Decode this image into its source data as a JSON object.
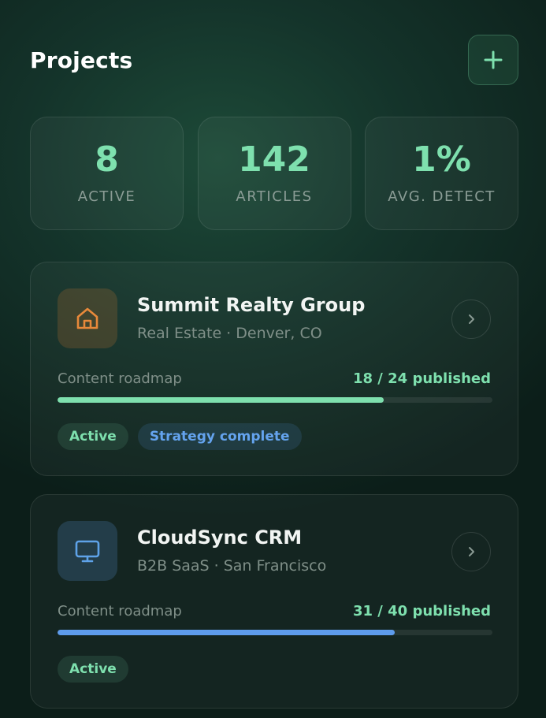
{
  "header": {
    "title": "Projects",
    "add_icon": "plus-icon"
  },
  "stats": [
    {
      "value": "8",
      "label": "ACTIVE"
    },
    {
      "value": "142",
      "label": "ARTICLES"
    },
    {
      "value": "1%",
      "label": "AVG. DETECT"
    }
  ],
  "projects": [
    {
      "name": "Summit Realty Group",
      "subtitle": "Real Estate · Denver, CO",
      "icon": "house-icon",
      "icon_color": "#e8893a",
      "progress_label": "Content roadmap",
      "progress_count": "18 / 24 published",
      "progress_fraction": 0.75,
      "progress_color": "#7ee0ae",
      "tags": [
        {
          "label": "Active"
        },
        {
          "label": "Strategy complete"
        }
      ]
    },
    {
      "name": "CloudSync CRM",
      "subtitle": "B2B SaaS · San Francisco",
      "icon": "monitor-icon",
      "icon_color": "#5ea2e8",
      "progress_label": "Content roadmap",
      "progress_count": "31 / 40 published",
      "progress_fraction": 0.775,
      "progress_color": "#5e9cec",
      "tags": [
        {
          "label": "Active"
        }
      ]
    }
  ],
  "colors": {
    "accent": "#7ee0ae",
    "muted": "#7f8f88"
  }
}
